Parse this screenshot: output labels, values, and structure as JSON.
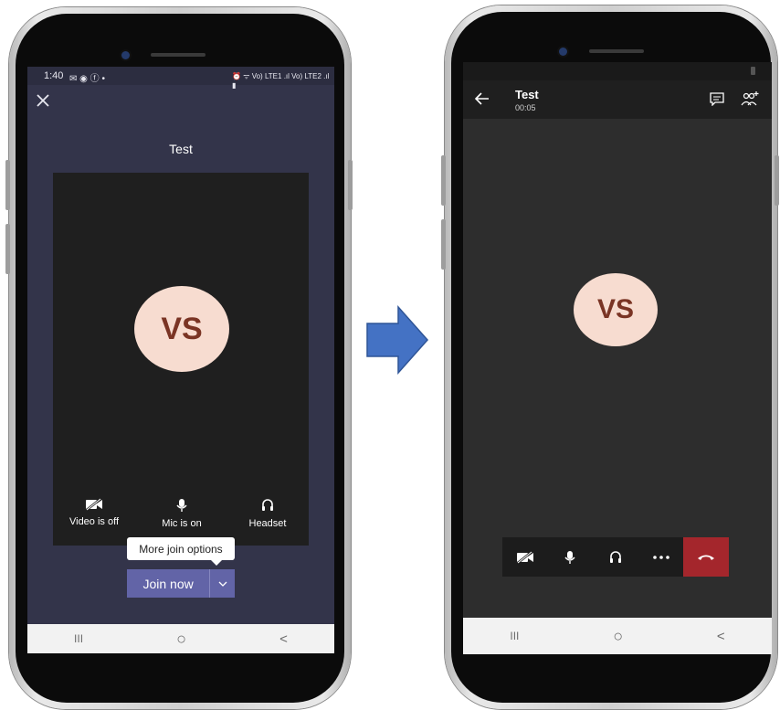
{
  "left_phone": {
    "status_time": "1:40",
    "status_left_icons": "✉ ◉ ⓕ •",
    "status_right_icons": "⏰ ᯤ Vo) LTE1 .ıl Vo) LTE2 .ıl ▮",
    "meeting_title": "Test",
    "avatar_initials": "VS",
    "controls": {
      "video_label": "Video is off",
      "mic_label": "Mic is on",
      "audio_label": "Headset"
    },
    "tooltip": "More join options",
    "join_label": "Join now",
    "nav": {
      "recents": "III",
      "home": "○",
      "back": "<"
    }
  },
  "arrow": {
    "color": "#4472c4"
  },
  "right_phone": {
    "title": "Test",
    "timer": "00:05",
    "avatar_initials": "VS",
    "hangup_color": "#a4262c",
    "nav": {
      "recents": "III",
      "home": "○",
      "back": "<"
    }
  },
  "colors": {
    "teams_purple": "#6264a7",
    "prejoin_bg": "#33344a",
    "call_bg": "#2d2d2d",
    "avatar_bg": "#f7dcd0",
    "avatar_text": "#7a3424"
  }
}
